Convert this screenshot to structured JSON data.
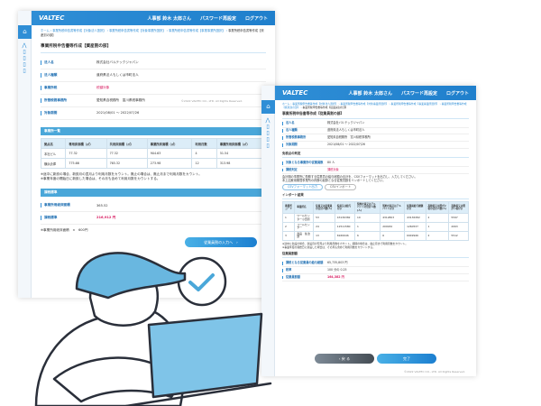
{
  "brand": "VALTEC",
  "header": {
    "user": "人事部 鈴木 太郎さん",
    "password": "パスワード再設定",
    "logout": "ログアウト"
  },
  "left": {
    "breadcrumb": [
      "ホーム",
      "事業所税申告書等作成【対象法人選択】",
      "事業所税申告書等作成【対象事業所選択】",
      "事業所税申告書等作成【事業事業所選択】",
      "事業所税申告書等作成【資産割の部】"
    ],
    "current": "事業所税申告書等作成【資産割の部】",
    "title": "事業所税申告書等作成【資産割の部】",
    "fields": [
      {
        "k": "法人名",
        "v": "株式会社バルテックジャパン"
      },
      {
        "k": "法人種類",
        "v": "道府県法人もしくは市町法人"
      },
      {
        "k": "事業所税",
        "v": "税額対象"
      },
      {
        "k": "所管税務事務所",
        "v": "愛知県自税務所　富川県税事務所"
      },
      {
        "k": "対象期間",
        "v": "2021/08/01 〜 2022/07/26"
      }
    ],
    "footer": "©2022 VALTEC CO., LTD. All Rights Reserved.",
    "list_title": "事業所一覧",
    "cols": [
      "拠点名",
      "専用床面積（㎡）",
      "共用床面積（㎡）",
      "事業所床面積（㎡）",
      "利用月数",
      "事業所用床面積（㎡）"
    ],
    "rows": [
      [
        "本社ビル",
        "77.32",
        "77.32",
        "904.63",
        "4",
        "51.54"
      ],
      [
        "横浜倉庫",
        "775.66",
        "765.32",
        "273.98",
        "12",
        "313.98"
      ]
    ],
    "notes": [
      "※途中に新設の場合、新設月の翌月より利用月数をカウント。廃止の場合は、廃止月まで利用月数をカウント。",
      "※事業年度の開始日に新設した場合は、その月も含めて利用月数をカウントする。"
    ],
    "tax_title": "課税標準",
    "tax": [
      {
        "k": "事業所用総床面積",
        "v": "365.52"
      },
      {
        "k": "課税標準",
        "v": "216,912 円"
      }
    ],
    "tax_note": "※事業所用総床面積　×　600円",
    "next": "従業員割の入力へ　›"
  },
  "right": {
    "breadcrumb": [
      "ホーム",
      "事業所税申告書等作成【対象法人選択】",
      "事業所税申告書等作成【対象事業所選択】",
      "事業所税申告書等作成【事業事業所選択】",
      "事業所税申告書等作成【資産割の部】"
    ],
    "current": "事業所税申告書等作成【従業員割の部】",
    "title": "事業所税申告書等作成【従業員割の部】",
    "fields": [
      {
        "k": "法人名",
        "v": "株式会社バルテックジャパン"
      },
      {
        "k": "法人種類",
        "v": "道府県法人もしくは市町法人"
      },
      {
        "k": "所管税務事務所",
        "v": "愛知県自税務所　富川県税事務所"
      },
      {
        "k": "対象期間",
        "v": "2021/08/01 〜 2022/07/26"
      }
    ],
    "emp_title": "免税点の判定",
    "emp": [
      {
        "k": "対象となる事業所の従業員数",
        "v": "80 人"
      },
      {
        "k": "課税判定",
        "v": "課税対象"
      }
    ],
    "instr": [
      "会計期の事業所に勤務する従業員の給与総額の合計を、CSVフォーマットを出力し、入力してください。",
      "本上記雇用期間事業所の判断の起算となる従業員数をインポートしてください。"
    ],
    "csv_out": "CSVフォーマット出力",
    "csv_in": "CSVインポート",
    "import_title": "インポート結果",
    "cols": [
      "事業所コード",
      "事業所名",
      "役員又は従業員の合計人数(人)",
      "役員又は給与(円)",
      "契約社員又はアルバイトの合計人数(人)",
      "契約社員又はアルバイト(円)",
      "従業員給与総額(円)",
      "高齢者又は障がい者の合計人数(人)",
      "高齢者又は障がい者(円)"
    ],
    "rows": [
      [
        "1",
        "ワールセンター小田原",
        "53",
        "43136382",
        "10",
        "4312803",
        "43136382",
        "2",
        "5597"
      ],
      [
        "2",
        "コールセンター",
        "24",
        "12511580",
        "1",
        "209182",
        "1260537",
        "1",
        "2063"
      ],
      [
        "3",
        "商品　佐治野",
        "13",
        "6949946",
        "6",
        "6",
        "6949946",
        "2",
        "5512"
      ]
    ],
    "notes": [
      "※途中に新設の場合、新設月の翌月より利用月数をカウント。期間の場合は、廃止月まで利用月数をカウント。",
      "※事業年度の開始日に新設した場合は、その月も含めて利用月数をカウントする。"
    ],
    "std_title": "従業員割額",
    "std": [
      {
        "k": "課税となる従業員の給与総額",
        "v": "65,735,803 円"
      },
      {
        "k": "税率",
        "v": "100 分の 0.25"
      },
      {
        "k": "従業員割額",
        "v": "164,382 円"
      }
    ],
    "back": "‹ 戻 る",
    "done": "完了",
    "footer": "©2022 VALTEC CO., LTD. All Rights Reserved."
  }
}
